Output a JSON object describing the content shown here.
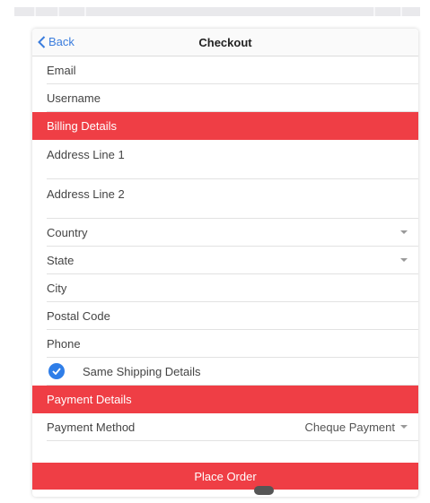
{
  "nav": {
    "back_label": "Back",
    "title": "Checkout"
  },
  "account": {
    "email_label": "Email",
    "username_label": "Username"
  },
  "billing": {
    "section_label": "Billing Details",
    "address1_label": "Address Line 1",
    "address2_label": "Address Line 2",
    "country_label": "Country",
    "state_label": "State",
    "city_label": "City",
    "postal_label": "Postal Code",
    "phone_label": "Phone",
    "same_shipping_label": "Same Shipping Details"
  },
  "payment": {
    "section_label": "Payment Details",
    "method_label": "Payment Method",
    "method_value": "Cheque Payment"
  },
  "actions": {
    "place_order_label": "Place Order"
  },
  "colors": {
    "accent_red": "#ef3e45",
    "link_blue": "#3b7ddd",
    "check_blue": "#2f7ee8"
  }
}
